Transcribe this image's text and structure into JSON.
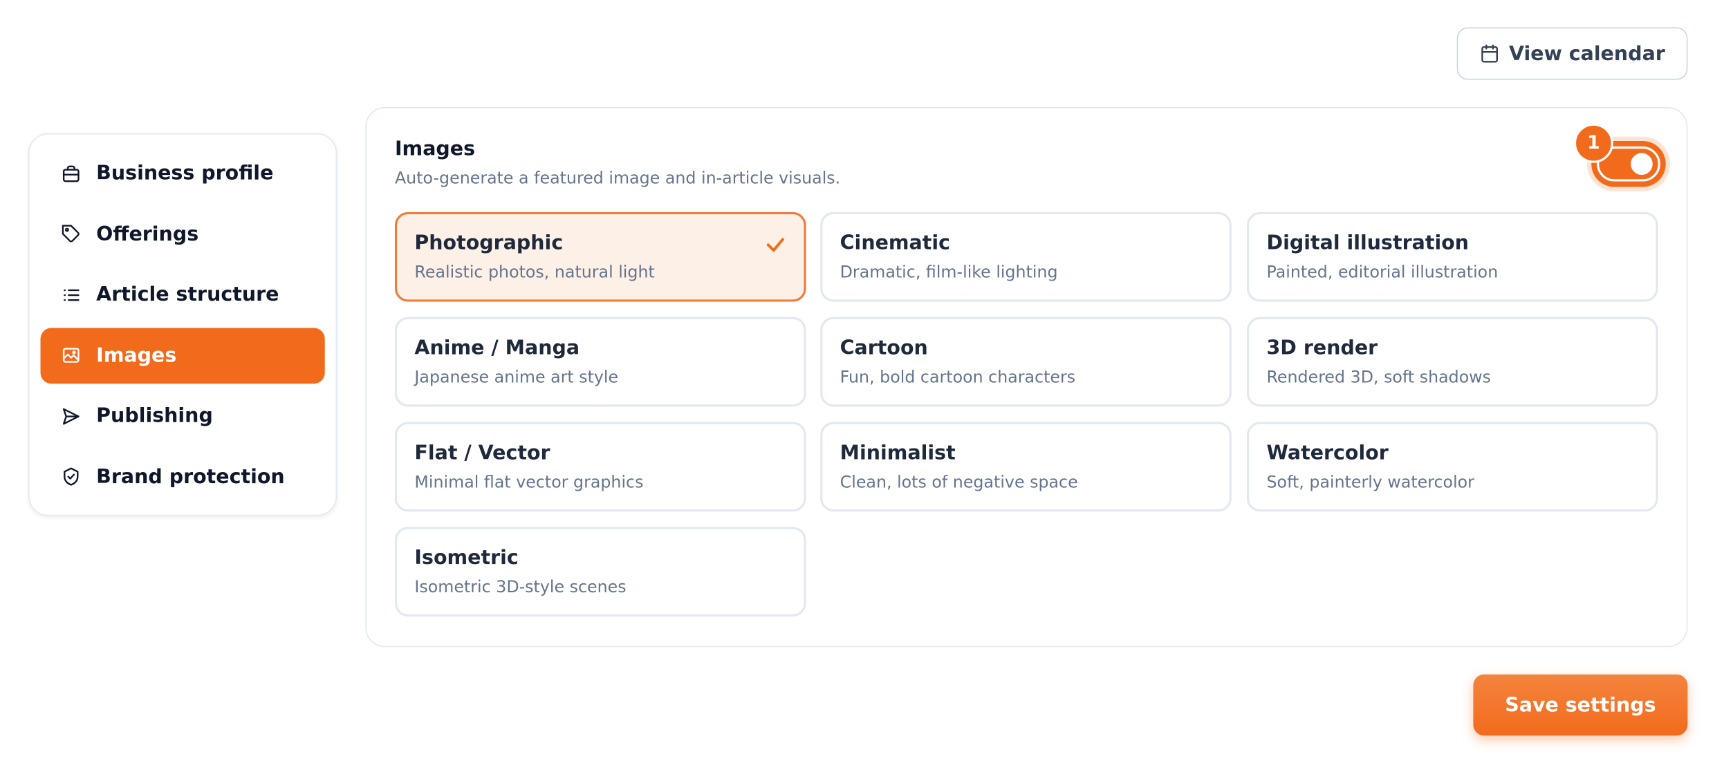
{
  "header": {
    "calendar_label": "View calendar"
  },
  "sidebar": {
    "items": [
      {
        "label": "Business profile",
        "icon": "briefcase-icon",
        "active": false
      },
      {
        "label": "Offerings",
        "icon": "tag-icon",
        "active": false
      },
      {
        "label": "Article structure",
        "icon": "list-icon",
        "active": false
      },
      {
        "label": "Images",
        "icon": "image-icon",
        "active": true
      },
      {
        "label": "Publishing",
        "icon": "send-icon",
        "active": false
      },
      {
        "label": "Brand protection",
        "icon": "shield-check-icon",
        "active": false
      }
    ]
  },
  "panel": {
    "title": "Images",
    "description": "Auto-generate a featured image and in-article visuals.",
    "toggle_on": true,
    "badge": "1",
    "styles": [
      {
        "title": "Photographic",
        "subtitle": "Realistic photos, natural light",
        "selected": true
      },
      {
        "title": "Cinematic",
        "subtitle": "Dramatic, film-like lighting",
        "selected": false
      },
      {
        "title": "Digital illustration",
        "subtitle": "Painted, editorial illustration",
        "selected": false
      },
      {
        "title": "Anime / Manga",
        "subtitle": "Japanese anime art style",
        "selected": false
      },
      {
        "title": "Cartoon",
        "subtitle": "Fun, bold cartoon characters",
        "selected": false
      },
      {
        "title": "3D render",
        "subtitle": "Rendered 3D, soft shadows",
        "selected": false
      },
      {
        "title": "Flat / Vector",
        "subtitle": "Minimal flat vector graphics",
        "selected": false
      },
      {
        "title": "Minimalist",
        "subtitle": "Clean, lots of negative space",
        "selected": false
      },
      {
        "title": "Watercolor",
        "subtitle": "Soft, painterly watercolor",
        "selected": false
      },
      {
        "title": "Isometric",
        "subtitle": "Isometric 3D-style scenes",
        "selected": false
      }
    ]
  },
  "footer": {
    "save_label": "Save settings"
  },
  "colors": {
    "accent": "#f26b1d",
    "selected_bg": "#fdf0e7",
    "text": "#1e293b",
    "muted": "#64748b",
    "border": "#e2e8f0"
  }
}
